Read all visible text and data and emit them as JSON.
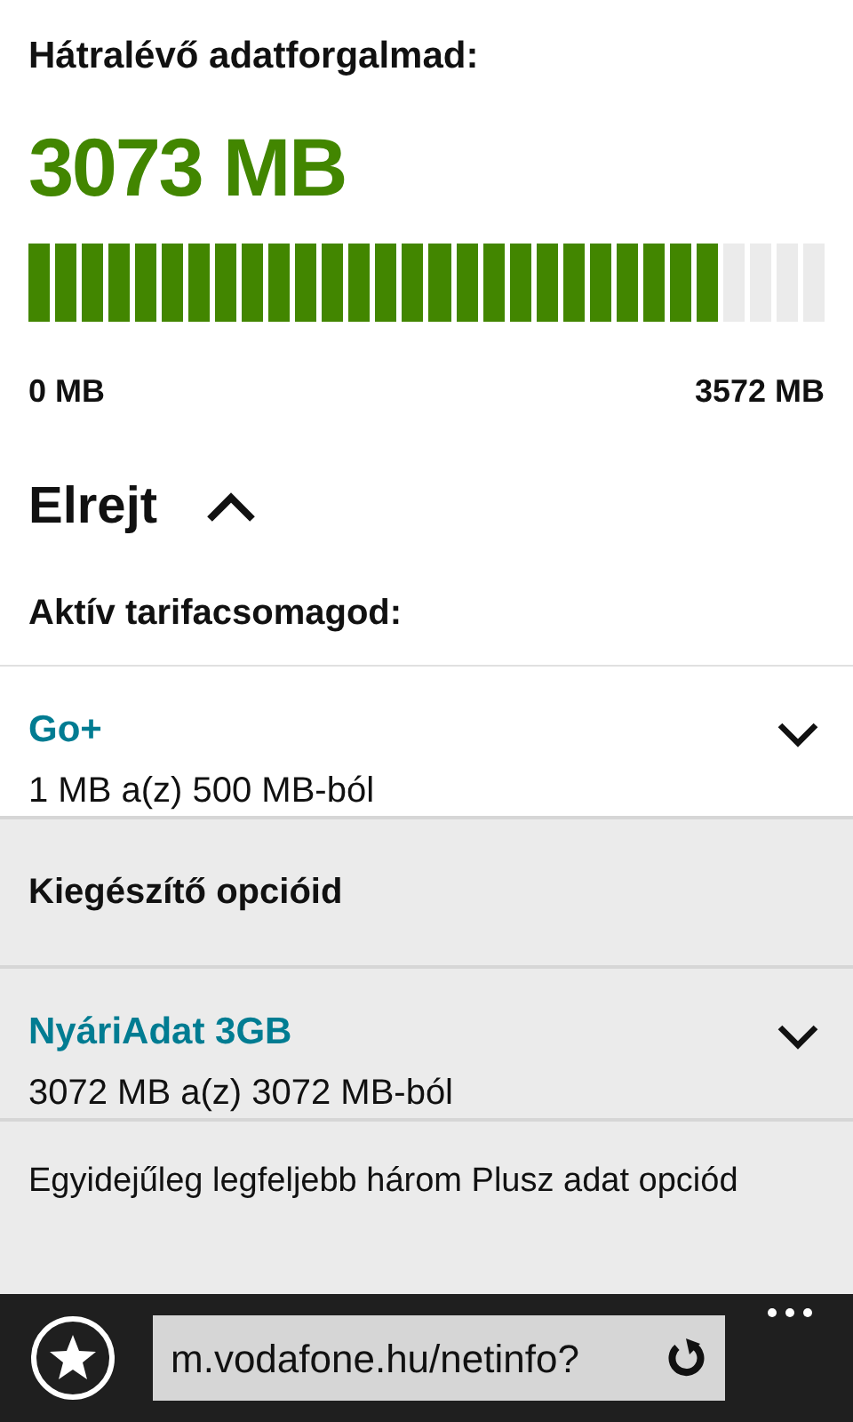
{
  "remaining_label": "Hátralévő adatforgalmad:",
  "remaining_value": "3073 MB",
  "meter": {
    "level": 0.86,
    "min_label": "0 MB",
    "max_label": "3572 MB"
  },
  "toggle": {
    "label": "Elrejt",
    "expanded": true
  },
  "active_heading": "Aktív tarifacsomagod:",
  "packages": [
    {
      "name": "Go+",
      "usage": "1 MB a(z) 500 MB-ból",
      "expanded": false
    },
    {
      "kind": "heading",
      "name": "Kiegészítő opcióid"
    },
    {
      "name": "NyáriAdat 3GB",
      "usage": "3072 MB a(z) 3072 MB-ból",
      "expanded": false
    }
  ],
  "note": "Egyidejűleg legfeljebb három Plusz adat opciód",
  "browser_bar": {
    "url": "m.vodafone.hu/netinfo?"
  }
}
